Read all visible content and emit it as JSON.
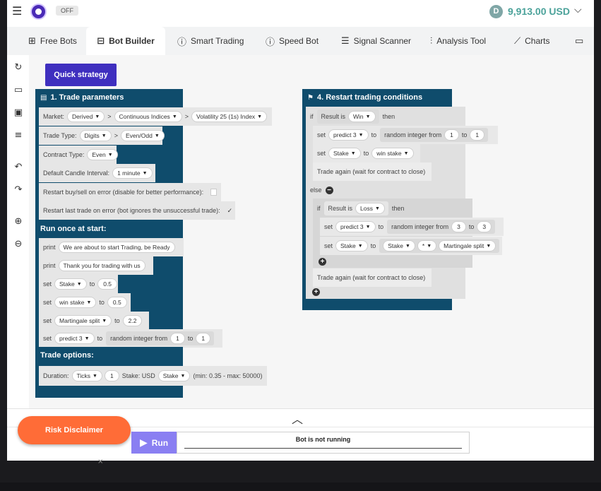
{
  "header": {
    "mode_badge": "OFF",
    "balance_icon": "D",
    "balance": "9,913.00 USD"
  },
  "tabs": [
    {
      "label": "Free Bots",
      "icon": "free-bots-icon"
    },
    {
      "label": "Bot Builder",
      "icon": "bot-builder-icon"
    },
    {
      "label": "Smart Trading",
      "icon": "smart-trading-icon"
    },
    {
      "label": "Speed Bot",
      "icon": "speed-bot-icon"
    },
    {
      "label": "Signal Scanner",
      "icon": "signal-scanner-icon"
    },
    {
      "label": "Analysis Tool",
      "icon": "analysis-tool-icon"
    },
    {
      "label": "Charts",
      "icon": "charts-icon"
    }
  ],
  "quick_strategy": "Quick strategy",
  "trade_params": {
    "title": "1. Trade parameters",
    "market_label": "Market:",
    "market": "Derived",
    "submarket": "Continuous Indices",
    "symbol": "Volatility 25 (1s) Index",
    "trade_type_label": "Trade Type:",
    "trade_type": "Digits",
    "trade_subtype": "Even/Odd",
    "contract_type_label": "Contract Type:",
    "contract_type": "Even",
    "candle_label": "Default Candle Interval:",
    "candle": "1 minute",
    "restart_buy_label": "Restart buy/sell on error (disable for better performance):",
    "restart_last_label": "Restart last trade on error (bot ignores the unsuccessful trade):",
    "restart_last_check": "✓"
  },
  "run_once": {
    "title": "Run once at start:",
    "print1_kw": "print",
    "print1": "We are about to start Trading, be Ready",
    "print2_kw": "print",
    "print2": "Thank you for trading with us",
    "set_kw": "set",
    "to_kw": "to",
    "var1": "Stake",
    "val1": "0.5",
    "var2": "win stake",
    "val2": "0.5",
    "var3": "Martingale split",
    "val3": "2.2",
    "var4": "predict 3",
    "rand_label": "random integer from",
    "rand_from": "1",
    "rand_to_kw": "to",
    "rand_to": "1"
  },
  "trade_options": {
    "title": "Trade options:",
    "duration_label": "Duration:",
    "duration_unit": "Ticks",
    "duration_value": "1",
    "stake_label": "Stake: USD",
    "stake_var": "Stake",
    "limits": "(min: 0.35 - max: 50000)"
  },
  "restart": {
    "title": "4. Restart trading conditions",
    "if_kw": "if",
    "result_is": "Result is",
    "win": "Win",
    "then_kw": "then",
    "set_kw": "set",
    "to_kw": "to",
    "predict": "predict 3",
    "rand_label": "random integer from",
    "r1_from": "1",
    "r1_to": "1",
    "stake": "Stake",
    "win_stake": "win stake",
    "trade_again": "Trade again (wait for contract to close)",
    "else_kw": "else",
    "loss": "Loss",
    "r2_from": "3",
    "r2_to": "3",
    "mult_op": "*",
    "martingale": "Martingale split",
    "trade_again2": "Trade again (wait for contract to close)"
  },
  "footer": {
    "risk": "Risk Disclaimer",
    "run": "Run",
    "status": "Bot is not running"
  }
}
